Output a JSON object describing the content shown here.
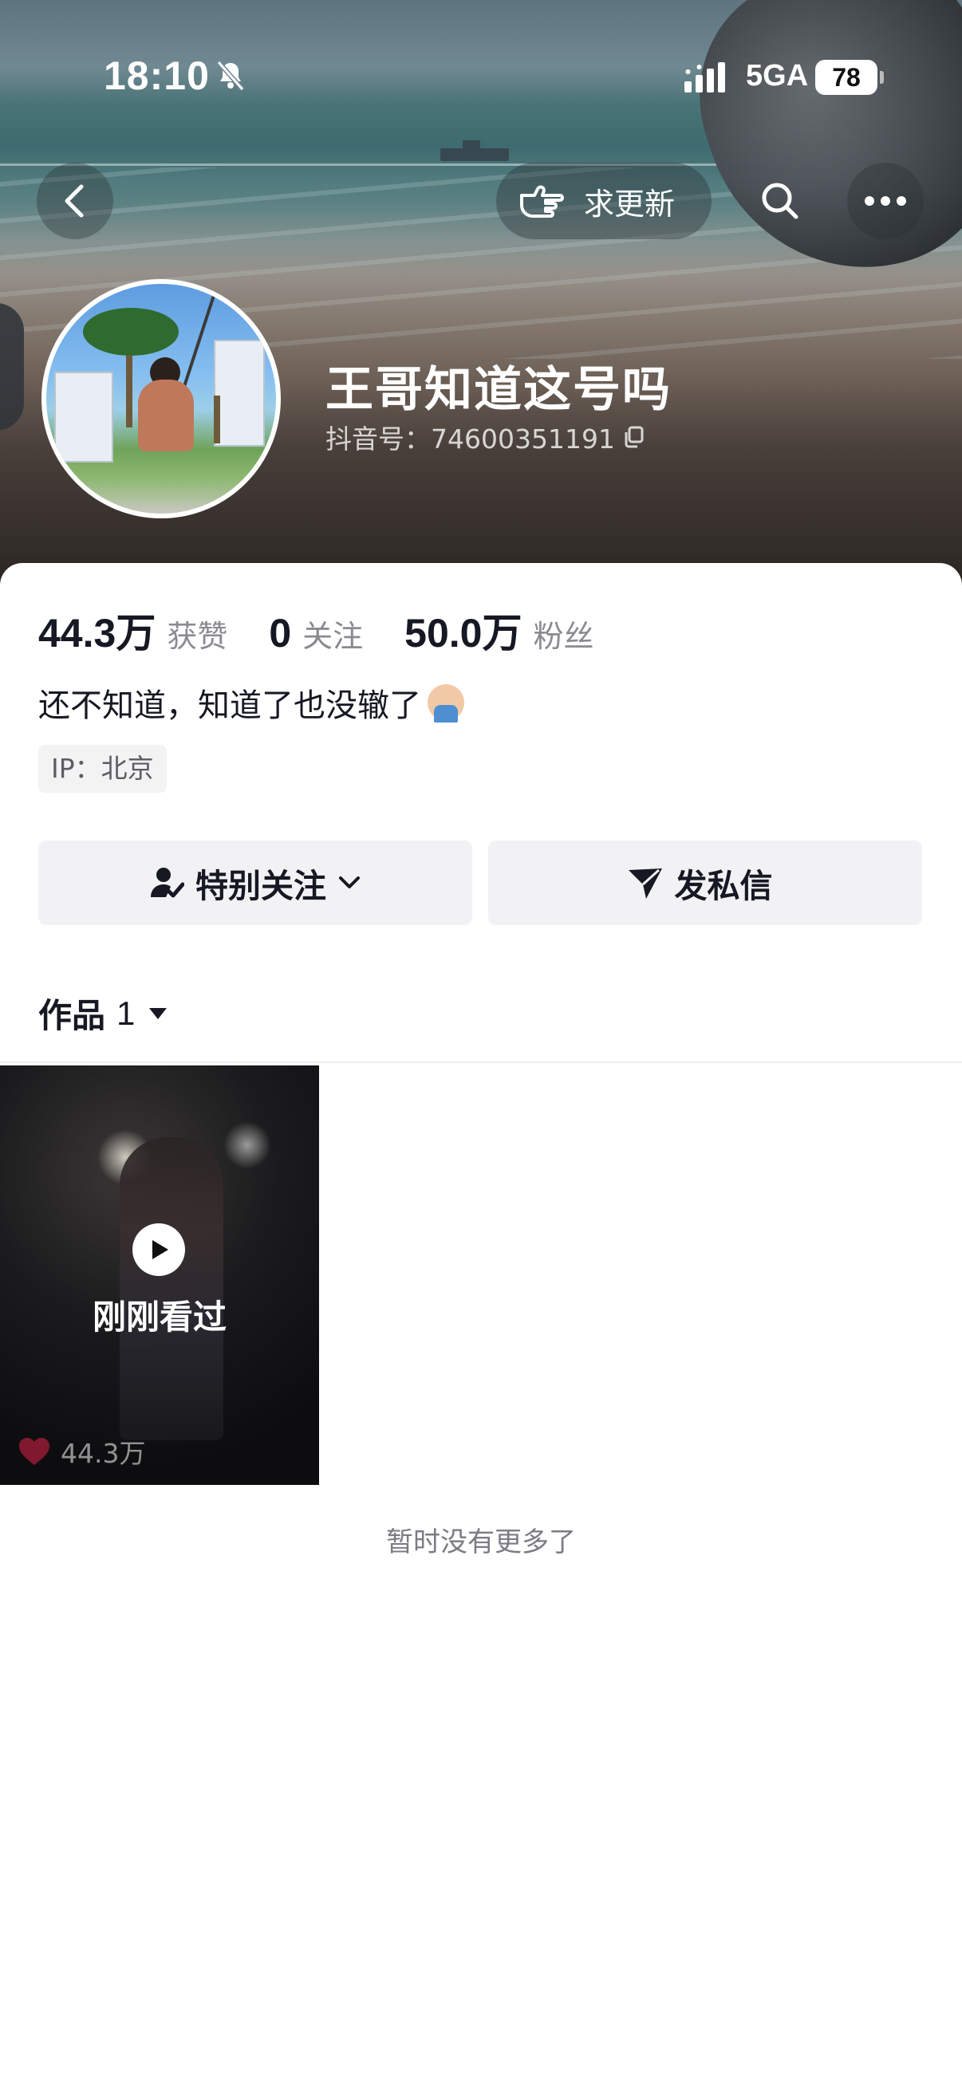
{
  "status_bar": {
    "time": "18:10",
    "network": "5GA",
    "battery": "78"
  },
  "nav": {
    "request_update_label": "求更新"
  },
  "profile": {
    "name": "王哥知道这号吗",
    "douyin_id": "抖音号：74600351191"
  },
  "stats": [
    {
      "value": "44.3万",
      "label": "获赞"
    },
    {
      "value": "0",
      "label": "关注"
    },
    {
      "value": "50.0万",
      "label": "粉丝"
    }
  ],
  "bio": "还不知道，知道了也没辙了",
  "ip_location": "IP：北京",
  "actions": {
    "follow_label": "特别关注",
    "message_label": "发私信"
  },
  "works_tab": {
    "label": "作品",
    "count": "1"
  },
  "videos": [
    {
      "badge": "刚刚看过",
      "likes": "44.3万"
    }
  ],
  "footer": "暂时没有更多了",
  "colors": {
    "like_heart": "#e0224a",
    "text_primary": "#161823",
    "text_secondary": "#8a8b91"
  }
}
